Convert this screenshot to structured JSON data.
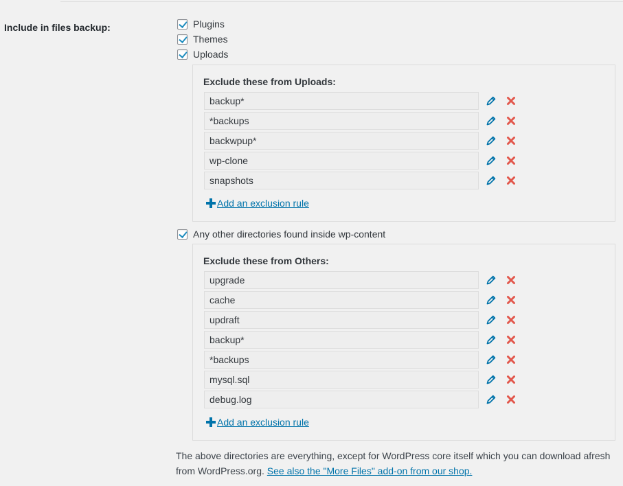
{
  "section": {
    "label": "Include in files backup:",
    "checkboxes": [
      {
        "label": "Plugins",
        "checked": true
      },
      {
        "label": "Themes",
        "checked": true
      },
      {
        "label": "Uploads",
        "checked": true
      }
    ]
  },
  "uploads_panel": {
    "title": "Exclude these from Uploads:",
    "rules": [
      "backup*",
      "*backups",
      "backwpup*",
      "wp-clone",
      "snapshots"
    ],
    "add_label": "Add an exclusion rule"
  },
  "others_checkbox": {
    "label": "Any other directories found inside wp-content",
    "checked": true
  },
  "others_panel": {
    "title": "Exclude these from Others:",
    "rules": [
      "upgrade",
      "cache",
      "updraft",
      "backup*",
      "*backups",
      "mysql.sql",
      "debug.log"
    ],
    "add_label": "Add an exclusion rule"
  },
  "footer": {
    "text": "The above directories are everything, except for WordPress core itself which you can download afresh from WordPress.org.",
    "link": "See also the \"More Files\" add-on from our shop."
  },
  "icons": {
    "edit": "pencil-icon",
    "delete": "x-icon",
    "add": "plus-icon"
  },
  "colors": {
    "accent": "#0073aa",
    "check": "#1e8cbe",
    "delete": "#e2574c",
    "edit": "#0073aa"
  }
}
